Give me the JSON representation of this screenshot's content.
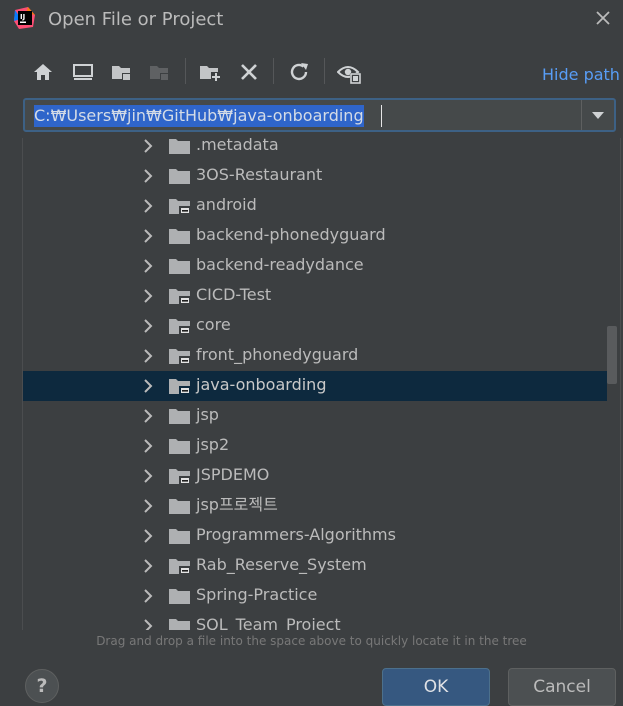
{
  "window": {
    "title": "Open File or Project"
  },
  "toolbar": {
    "buttons": [
      {
        "name": "home-icon"
      },
      {
        "name": "desktop-icon"
      },
      {
        "name": "project-folder-icon"
      },
      {
        "name": "module-folder-icon"
      },
      {
        "name": "new-folder-icon"
      },
      {
        "name": "delete-icon"
      },
      {
        "name": "refresh-icon"
      },
      {
        "name": "show-hidden-icon"
      }
    ],
    "hide_path_label": "Hide path"
  },
  "path": {
    "value": "C:₩Users₩jin₩GitHub₩java-onboarding"
  },
  "tree": {
    "items": [
      {
        "label": ".metadata",
        "type": "folder"
      },
      {
        "label": "3OS-Restaurant",
        "type": "folder"
      },
      {
        "label": "android",
        "type": "project"
      },
      {
        "label": "backend-phonedyguard",
        "type": "folder"
      },
      {
        "label": "backend-readydance",
        "type": "folder"
      },
      {
        "label": "CICD-Test",
        "type": "project"
      },
      {
        "label": "core",
        "type": "project"
      },
      {
        "label": "front_phonedyguard",
        "type": "project"
      },
      {
        "label": "java-onboarding",
        "type": "project",
        "selected": true
      },
      {
        "label": "jsp",
        "type": "folder"
      },
      {
        "label": "jsp2",
        "type": "folder"
      },
      {
        "label": "JSPDEMO",
        "type": "project"
      },
      {
        "label": "jsp프로젝트",
        "type": "folder"
      },
      {
        "label": "Programmers-Algorithms",
        "type": "folder"
      },
      {
        "label": "Rab_Reserve_System",
        "type": "project"
      },
      {
        "label": "Spring-Practice",
        "type": "folder"
      },
      {
        "label": "SQL_Team_Project",
        "type": "folder"
      }
    ]
  },
  "hint": "Drag and drop a file into the space above to quickly locate it in the tree",
  "footer": {
    "help_label": "?",
    "ok_label": "OK",
    "cancel_label": "Cancel"
  },
  "colors": {
    "background": "#3c3f41",
    "selection": "#0d293e",
    "path_highlight": "#2f65ca",
    "link": "#589df6",
    "primary_button": "#365880"
  }
}
